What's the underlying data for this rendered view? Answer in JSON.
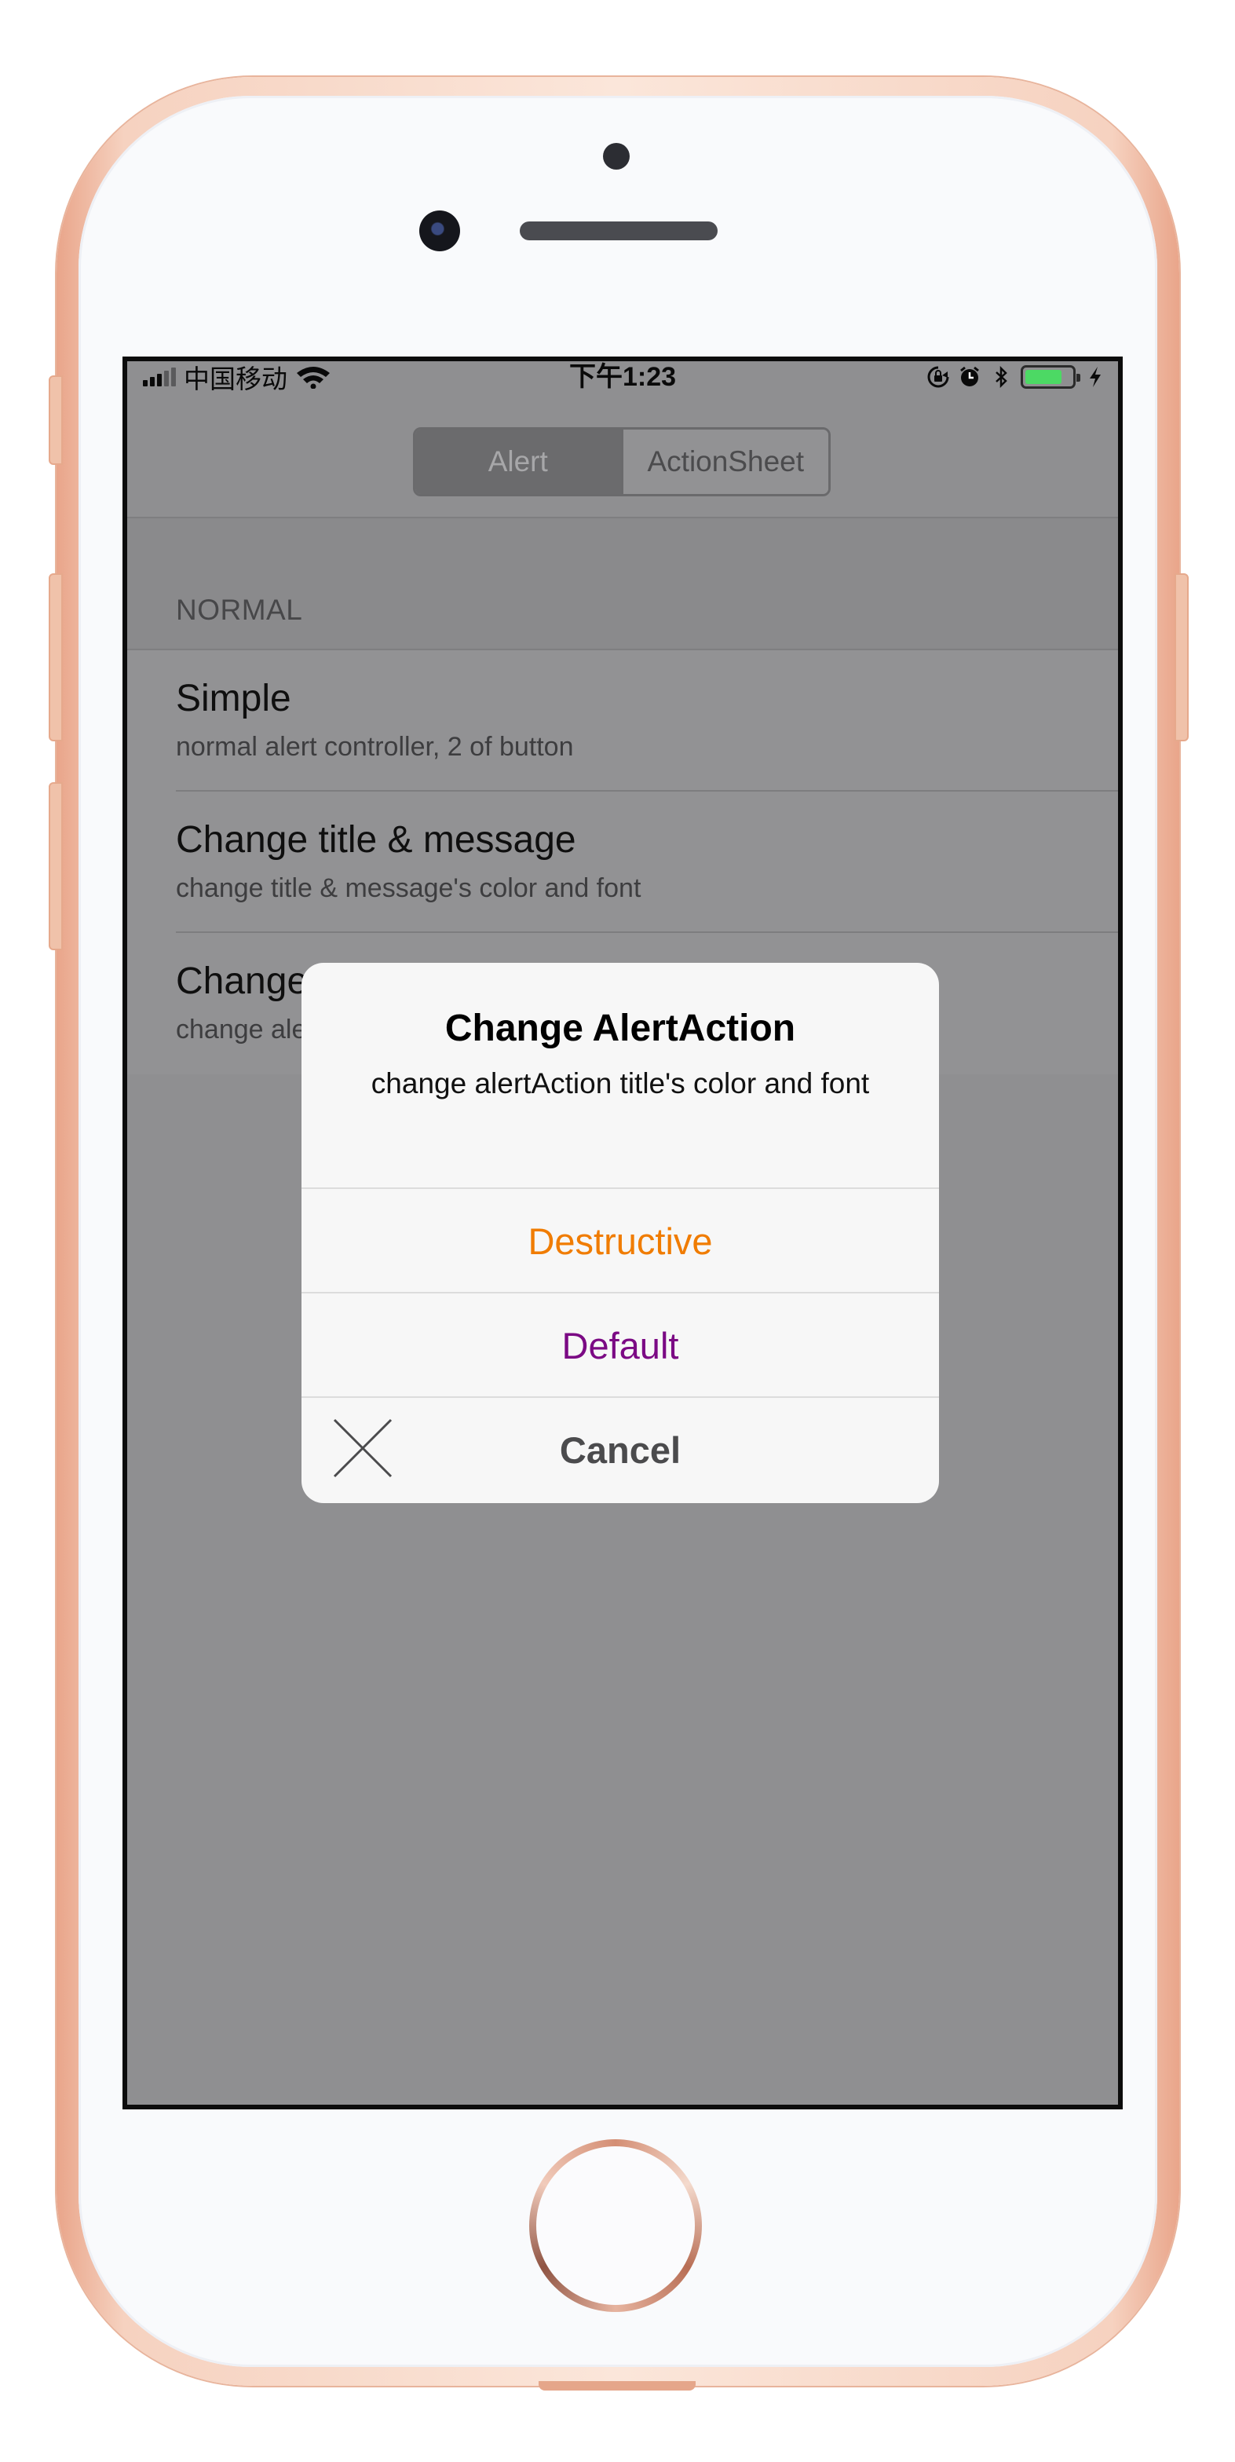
{
  "statusbar": {
    "carrier": "中国移动",
    "time": "下午1:23",
    "battery_level": 0.82,
    "battery_color": "#4cd964"
  },
  "segmented_control": {
    "items": [
      "Alert",
      "ActionSheet"
    ],
    "selected": "Alert"
  },
  "section": {
    "header": "NORMAL"
  },
  "cells": [
    {
      "title": "Simple",
      "subtitle": "normal alert controller, 2 of button"
    },
    {
      "title": "Change title & message",
      "subtitle": "change title & message's color and font"
    },
    {
      "title": "Change AlertAction",
      "subtitle": "change alertAction title's color and font"
    }
  ],
  "alert": {
    "title": "Change AlertAction",
    "message": "change alertAction title's color and font",
    "buttons": [
      {
        "label": "Destructive",
        "color": "#f07c00"
      },
      {
        "label": "Default",
        "color": "#7b0a84"
      },
      {
        "label": "Cancel",
        "color": "#4b4b4d",
        "icon": "close-x-icon"
      }
    ]
  },
  "icons": [
    "signal-icon",
    "wifi-icon",
    "orientation-lock-icon",
    "alarm-icon",
    "bluetooth-icon",
    "battery-icon",
    "charging-icon"
  ]
}
